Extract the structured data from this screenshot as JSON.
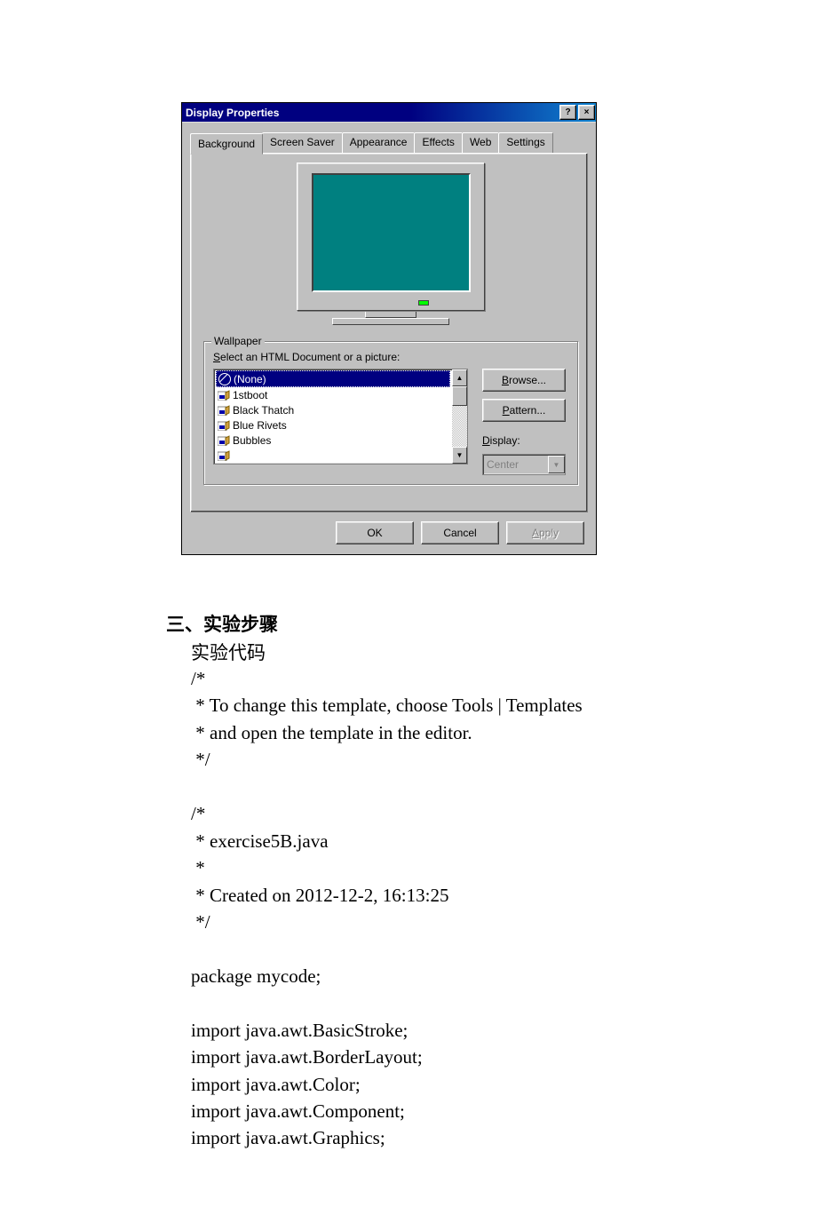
{
  "dialog": {
    "title": "Display Properties",
    "help_symbol": "?",
    "close_symbol": "×",
    "tabs": [
      "Background",
      "Screen Saver",
      "Appearance",
      "Effects",
      "Web",
      "Settings"
    ],
    "active_tab_index": 0,
    "wallpaper": {
      "legend": "Wallpaper",
      "label_prefix": "S",
      "label_rest": "elect an HTML Document or a picture:",
      "items": [
        "(None)",
        "1stboot",
        "Black Thatch",
        "Blue Rivets",
        "Bubbles"
      ],
      "selected_index": 0,
      "browse_u": "B",
      "browse_rest": "rowse...",
      "pattern_u": "P",
      "pattern_rest": "attern...",
      "display_u": "D",
      "display_rest": "isplay:",
      "display_value": "Center"
    },
    "buttons": {
      "ok": "OK",
      "cancel": "Cancel",
      "apply_u": "A",
      "apply_rest": "pply"
    }
  },
  "doc": {
    "heading": "三、实验步骤",
    "subheading": "实验代码",
    "code": "/*\n * To change this template, choose Tools | Templates\n * and open the template in the editor.\n */\n\n/*\n * exercise5B.java\n *\n * Created on 2012-12-2, 16:13:25\n */\n\npackage mycode;\n\nimport java.awt.BasicStroke;\nimport java.awt.BorderLayout;\nimport java.awt.Color;\nimport java.awt.Component;\nimport java.awt.Graphics;"
  }
}
